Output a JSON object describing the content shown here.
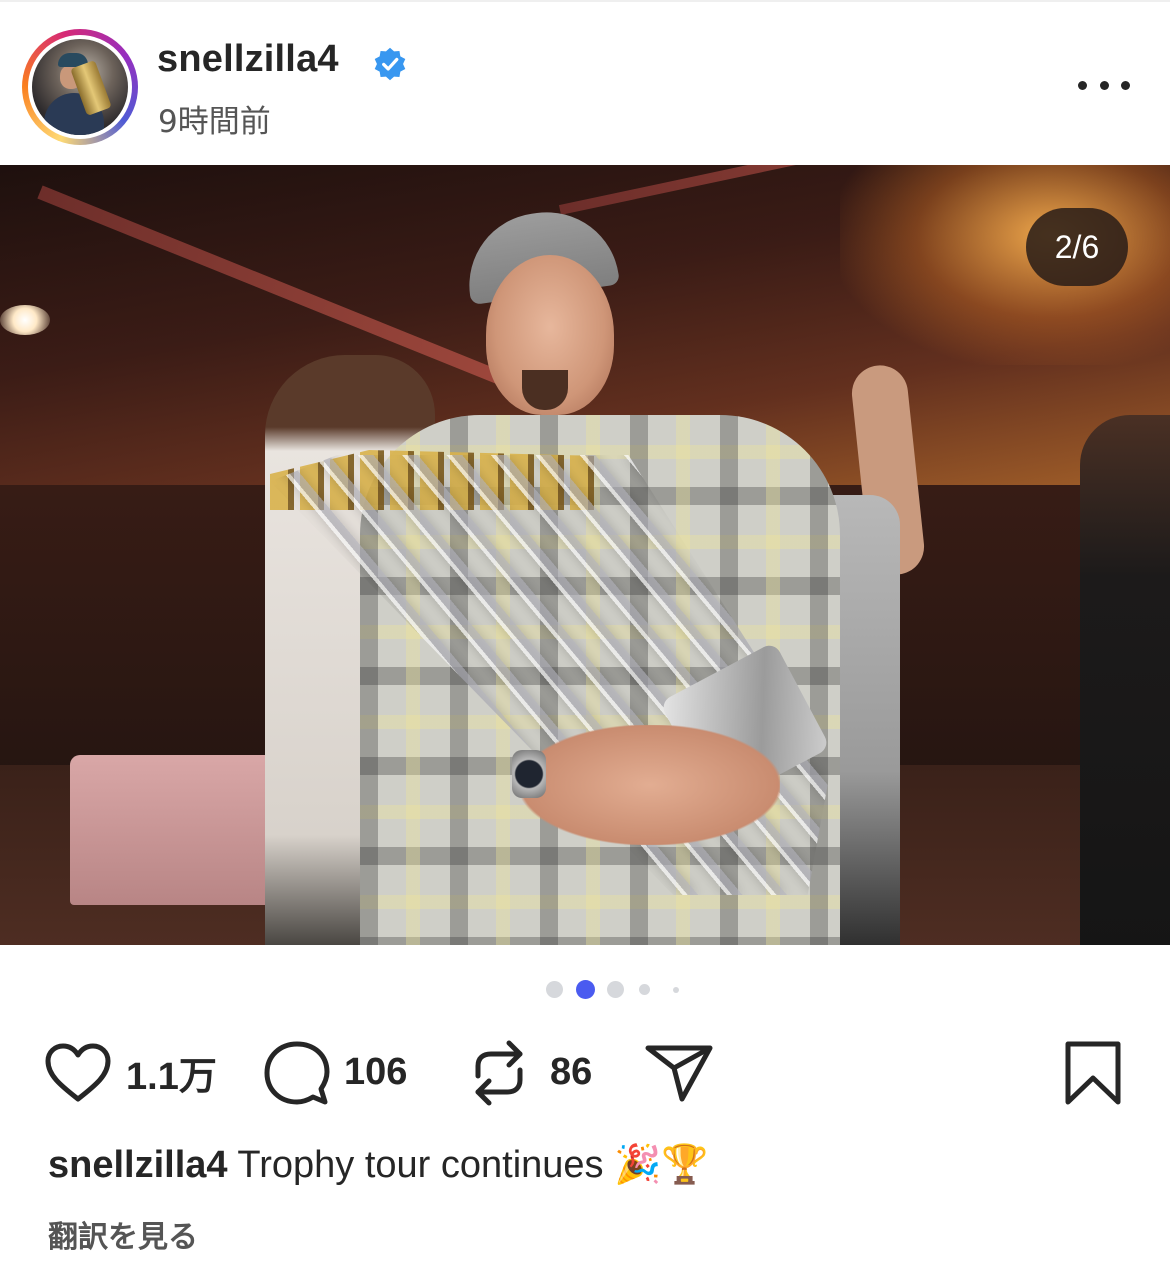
{
  "post": {
    "username": "snellzilla4",
    "timestamp": "9時間前",
    "verified": true,
    "image_counter": "2/6"
  },
  "carousel": {
    "total_visible_dots": 5,
    "active_index": 1,
    "active_color": "#4a5bf0"
  },
  "actions": {
    "like_count": "1.1万",
    "comment_count": "106",
    "repost_count": "86"
  },
  "caption": {
    "username": "snellzilla4",
    "text": "Trophy tour continues",
    "emoji": "🎉🏆"
  },
  "translate_label": "翻訳を見る",
  "icons": {
    "more": "more-horizontal-icon",
    "like": "heart-icon",
    "comment": "comment-bubble-icon",
    "repost": "repost-icon",
    "share": "send-icon",
    "save": "bookmark-icon",
    "verified": "verified-badge-icon"
  },
  "colors": {
    "verified_blue": "#3897f0",
    "text": "#262626"
  }
}
